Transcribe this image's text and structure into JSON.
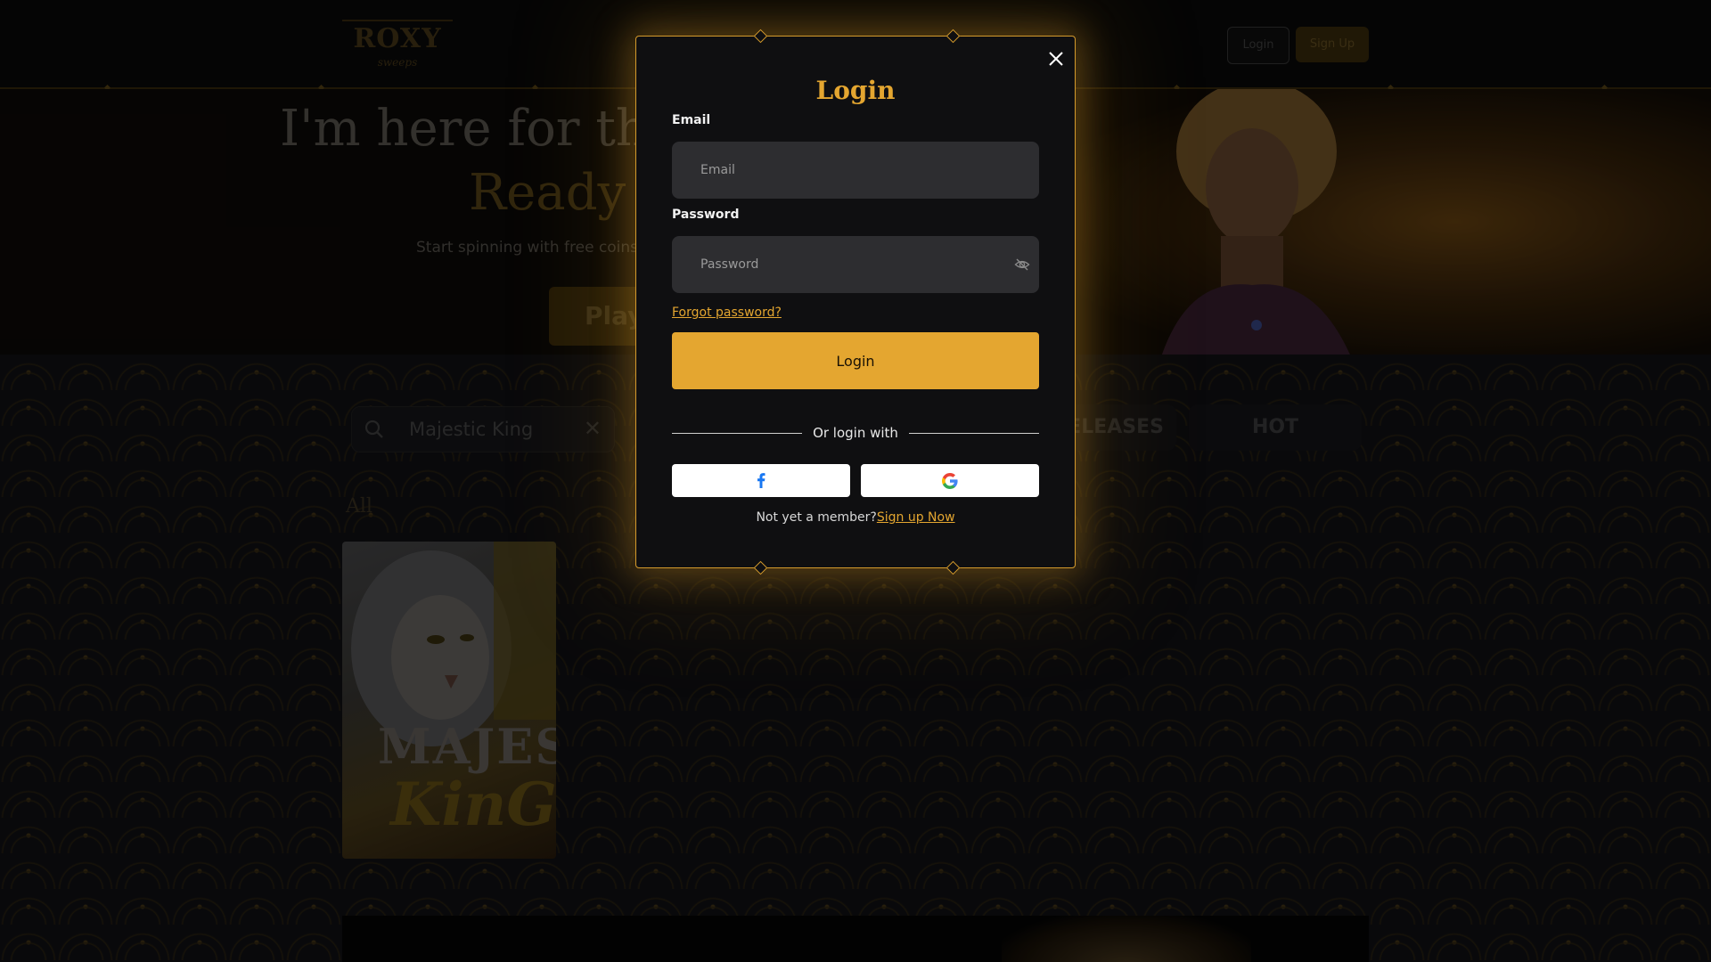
{
  "site": {
    "logo_text": "ROXY",
    "logo_sub": "sweeps",
    "header_login": "Login",
    "header_signup": "Sign Up"
  },
  "hero": {
    "title": "I'm here for the",
    "subtitle": "Ready",
    "tagline": "Start spinning with free coins",
    "play_label": "Play"
  },
  "lobby": {
    "search_value": "Majestic King",
    "tabs": [
      {
        "label": "ELEASES"
      },
      {
        "label": "HOT"
      }
    ],
    "section_label": "All",
    "game_card": {
      "title_line1": "MAJEST",
      "title_line2": "KinG"
    }
  },
  "modal": {
    "title": "Login",
    "email_label": "Email",
    "email_placeholder": "Email",
    "email_value": "",
    "password_label": "Password",
    "password_placeholder": "Password",
    "password_value": "",
    "forgot_password": "Forgot password?",
    "login_button": "Login",
    "divider_text": "Or login with",
    "social": [
      {
        "name": "facebook",
        "icon": "facebook-icon"
      },
      {
        "name": "google",
        "icon": "google-icon"
      }
    ],
    "signup_prompt": "Not yet a member?",
    "signup_link": "Sign up Now"
  },
  "colors": {
    "accent": "#e4a630",
    "modal_bg": "#0f0f11",
    "input_bg": "#2d2d30"
  }
}
